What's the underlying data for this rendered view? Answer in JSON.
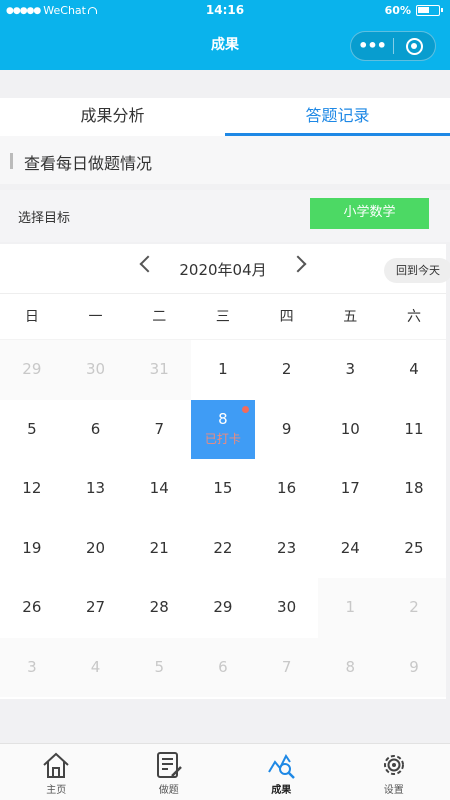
{
  "status_bar": {
    "carrier": "WeChat",
    "time": "14:16",
    "battery": "60%",
    "battery_level": 0.6
  },
  "nav": {
    "title": "成果",
    "more": "•••"
  },
  "tabs": [
    {
      "label": "成果分析",
      "active": false
    },
    {
      "label": "答题记录",
      "active": true
    }
  ],
  "section_title": "查看每日做题情况",
  "target": {
    "label": "选择目标",
    "button": "小学数学"
  },
  "calendar": {
    "month_label": "2020年04月",
    "today_button": "回到今天",
    "weekdays": [
      "日",
      "一",
      "二",
      "三",
      "四",
      "五",
      "六"
    ],
    "days": [
      {
        "d": "29",
        "other": true
      },
      {
        "d": "30",
        "other": true
      },
      {
        "d": "31",
        "other": true
      },
      {
        "d": "1"
      },
      {
        "d": "2"
      },
      {
        "d": "3"
      },
      {
        "d": "4"
      },
      {
        "d": "5"
      },
      {
        "d": "6"
      },
      {
        "d": "7"
      },
      {
        "d": "8",
        "checked": true,
        "mark": "已打卡"
      },
      {
        "d": "9"
      },
      {
        "d": "10"
      },
      {
        "d": "11"
      },
      {
        "d": "12"
      },
      {
        "d": "13"
      },
      {
        "d": "14"
      },
      {
        "d": "15"
      },
      {
        "d": "16"
      },
      {
        "d": "17"
      },
      {
        "d": "18"
      },
      {
        "d": "19"
      },
      {
        "d": "20"
      },
      {
        "d": "21"
      },
      {
        "d": "22"
      },
      {
        "d": "23"
      },
      {
        "d": "24"
      },
      {
        "d": "25"
      },
      {
        "d": "26"
      },
      {
        "d": "27"
      },
      {
        "d": "28"
      },
      {
        "d": "29"
      },
      {
        "d": "30"
      },
      {
        "d": "1",
        "other": true
      },
      {
        "d": "2",
        "other": true
      },
      {
        "d": "3",
        "other": true
      },
      {
        "d": "4",
        "other": true
      },
      {
        "d": "5",
        "other": true
      },
      {
        "d": "6",
        "other": true
      },
      {
        "d": "7",
        "other": true
      },
      {
        "d": "8",
        "other": true
      },
      {
        "d": "9",
        "other": true
      }
    ]
  },
  "tabbar": [
    {
      "label": "主页",
      "icon": "home-icon",
      "active": false
    },
    {
      "label": "做题",
      "icon": "exercise-icon",
      "active": false
    },
    {
      "label": "成果",
      "icon": "results-icon",
      "active": true
    },
    {
      "label": "设置",
      "icon": "settings-icon",
      "active": false
    }
  ],
  "colors": {
    "nav_bg": "#0ab3ec",
    "accent": "#1e88e5",
    "target_button": "#4cd964",
    "checked_day": "#3f9cf5"
  }
}
